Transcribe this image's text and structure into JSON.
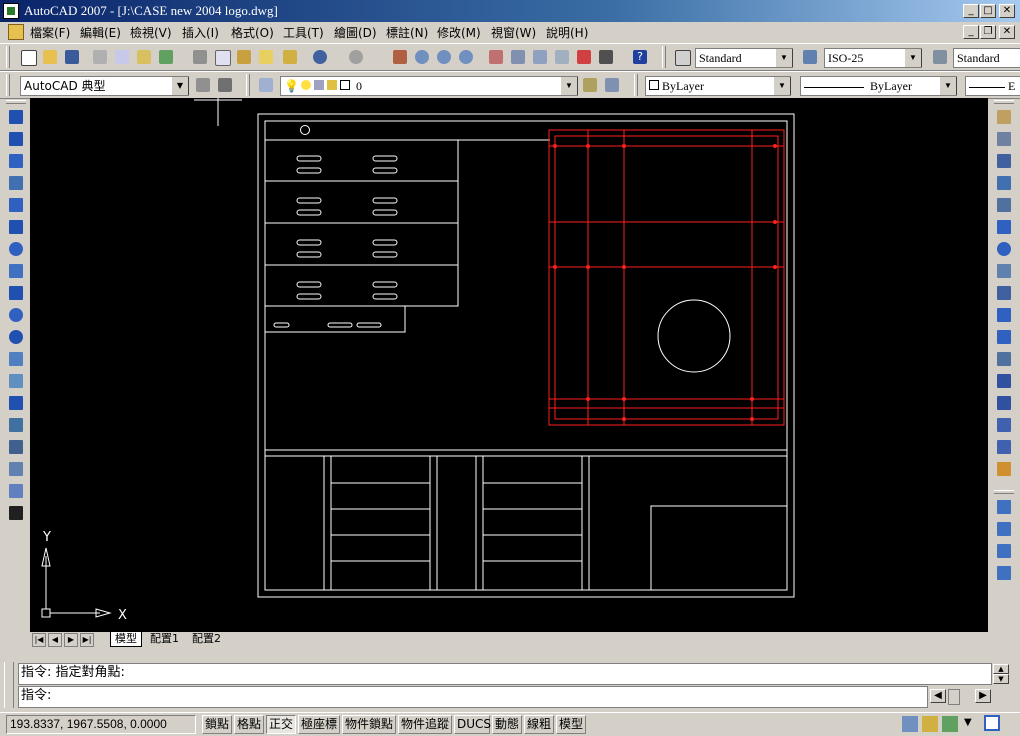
{
  "window": {
    "title": "AutoCAD 2007 - [J:\\CASE new 2004 logo.dwg]"
  },
  "menu": [
    {
      "label": "檔案(F)"
    },
    {
      "label": "編輯(E)"
    },
    {
      "label": "檢視(V)"
    },
    {
      "label": "插入(I)"
    },
    {
      "label": "格式(O)"
    },
    {
      "label": "工具(T)"
    },
    {
      "label": "繪圖(D)"
    },
    {
      "label": "標註(N)"
    },
    {
      "label": "修改(M)"
    },
    {
      "label": "視窗(W)"
    },
    {
      "label": "說明(H)"
    }
  ],
  "toolbar": {
    "text_style": "Standard",
    "dim_style": "ISO-25",
    "table_style": "Standard",
    "workspace": "AutoCAD 典型",
    "layer": "0",
    "color": "ByLayer",
    "linetype": "ByLayer",
    "lineweight": "E"
  },
  "drawing": {
    "ucs_y": "Y",
    "ucs_x": "X"
  },
  "tabs": [
    {
      "label": "模型",
      "active": true
    },
    {
      "label": "配置1",
      "active": false
    },
    {
      "label": "配置2",
      "active": false
    }
  ],
  "command": {
    "history": "指令: 指定對角點:",
    "prompt": "指令:"
  },
  "status": {
    "coordinates": "193.8337, 1967.5508, 0.0000",
    "buttons": [
      {
        "label": "鎖點",
        "on": false
      },
      {
        "label": "格點",
        "on": false
      },
      {
        "label": "正交",
        "on": true
      },
      {
        "label": "極座標",
        "on": false
      },
      {
        "label": "物件鎖點",
        "on": false
      },
      {
        "label": "物件追蹤",
        "on": false
      },
      {
        "label": "DUCS",
        "on": false
      },
      {
        "label": "動態",
        "on": false
      },
      {
        "label": "線粗",
        "on": false
      },
      {
        "label": "模型",
        "on": false
      }
    ]
  },
  "colors": {
    "canvas": "#000000",
    "drawing_lines": "#ffffff",
    "red_lines": "#ff2020",
    "title_bar": "#0a246a"
  },
  "icons": {
    "left_draw": [
      "line-icon",
      "construction-line-icon",
      "polyline-icon",
      "polygon-icon",
      "rectangle-icon",
      "arc-icon",
      "circle-icon",
      "revision-cloud-icon",
      "spline-icon",
      "ellipse-icon",
      "ellipse-arc-icon",
      "insert-block-icon",
      "make-block-icon",
      "point-icon",
      "hatch-icon",
      "gradient-icon",
      "region-icon",
      "table-icon",
      "multiline-text-icon"
    ],
    "right_modify": [
      "erase-icon",
      "copy-icon",
      "mirror-icon",
      "offset-icon",
      "array-icon",
      "move-icon",
      "rotate-icon",
      "scale-icon",
      "stretch-icon",
      "trim-icon",
      "extend-icon",
      "break-at-point-icon",
      "break-icon",
      "join-icon",
      "chamfer-icon",
      "fillet-icon",
      "explode-icon"
    ],
    "right_order": [
      "bring-to-front-icon",
      "send-to-back-icon",
      "bring-above-icon",
      "send-under-icon"
    ]
  }
}
